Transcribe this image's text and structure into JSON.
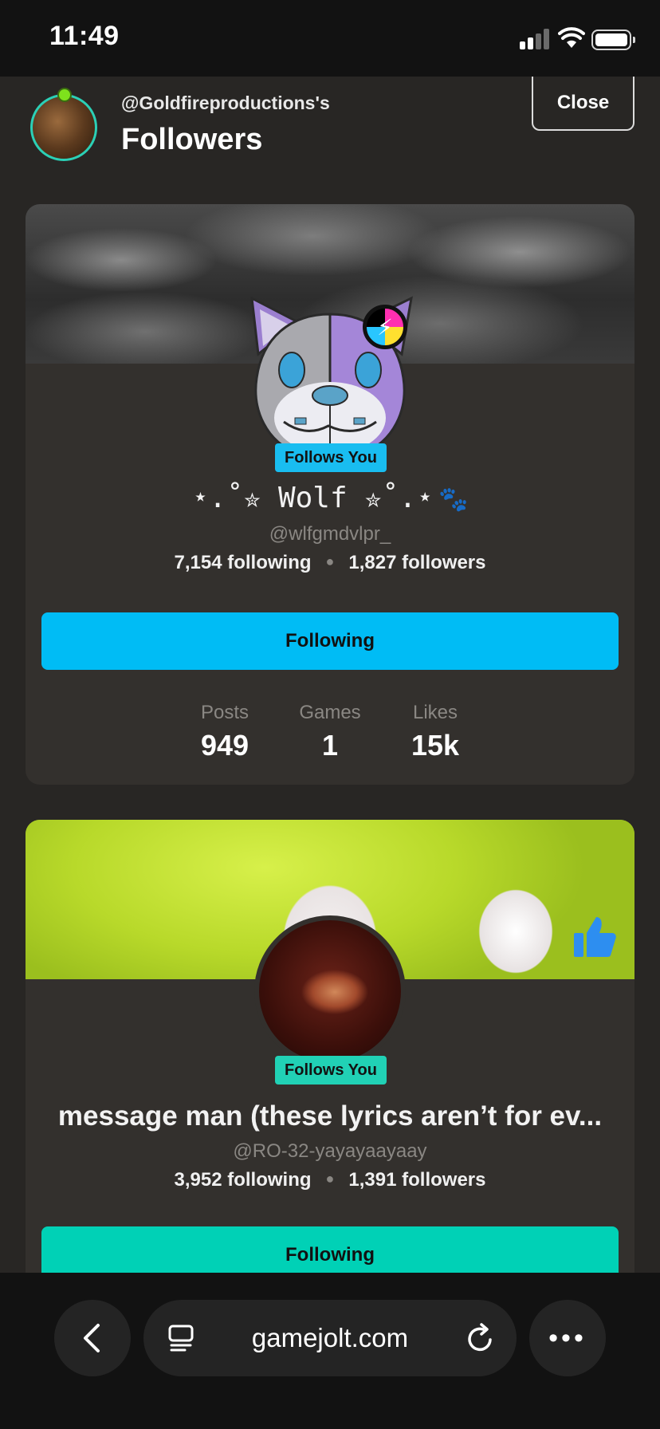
{
  "status_bar": {
    "time": "11:49"
  },
  "header": {
    "owner_line": "@Goldfireproductions's",
    "title": "Followers",
    "close_label": "Close"
  },
  "followers": [
    {
      "display_name": "⋆.˚✮ Wolf ✮˚.⋆",
      "handle": "@wlfgmdvlpr_",
      "follows_you": "Follows You",
      "following_count": "7,154 following",
      "followers_count": "1,827 followers",
      "button_label": "Following",
      "metrics": [
        {
          "label": "Posts",
          "value": "949"
        },
        {
          "label": "Games",
          "value": "1"
        },
        {
          "label": "Likes",
          "value": "15k"
        }
      ]
    },
    {
      "display_name": "message man (these lyrics aren’t for ev...",
      "handle": "@RO-32-yayayaayaay",
      "follows_you": "Follows You",
      "following_count": "3,952 following",
      "followers_count": "1,391 followers",
      "button_label": "Following"
    }
  ],
  "browser": {
    "url": "gamejolt.com",
    "more": "•••"
  },
  "colors": {
    "accent_blue": "#00bcf5",
    "accent_teal": "#00d1b6",
    "card_bg": "#33302d",
    "page_bg": "#282624"
  },
  "icons": [
    "back-chevron-icon",
    "tabs-icon",
    "reload-icon",
    "more-icon",
    "thumbs-up-icon",
    "paw-icon"
  ]
}
